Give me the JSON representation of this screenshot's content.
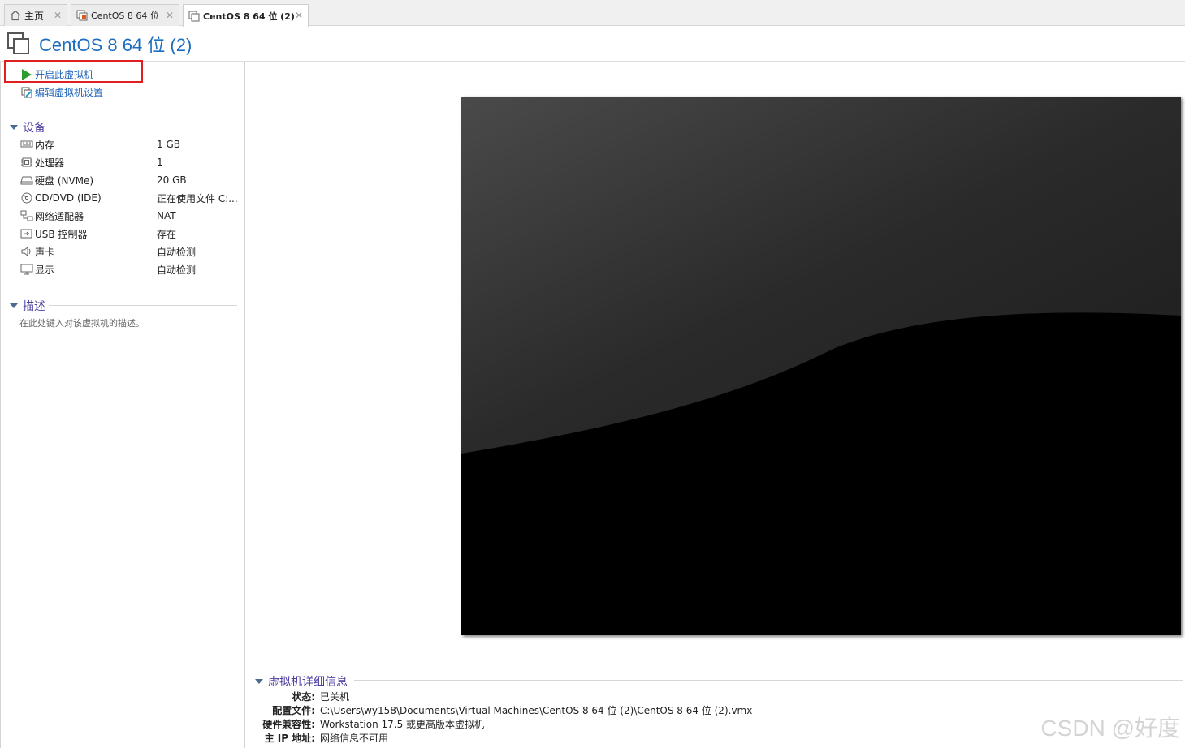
{
  "tabs": [
    {
      "label": "主页",
      "icon": "home-icon"
    },
    {
      "label": "CentOS 8 64 位",
      "icon": "vm-running-icon"
    },
    {
      "label": "CentOS 8 64 位 (2)",
      "icon": "vm-icon"
    }
  ],
  "page": {
    "title": "CentOS 8 64 位 (2)"
  },
  "actions": {
    "power_on": "开启此虚拟机",
    "edit_settings": "编辑虚拟机设置"
  },
  "devices": {
    "heading": "设备",
    "items": [
      {
        "name": "内存",
        "value": "1 GB",
        "icon": "memory-icon"
      },
      {
        "name": "处理器",
        "value": "1",
        "icon": "cpu-icon"
      },
      {
        "name": "硬盘 (NVMe)",
        "value": "20 GB",
        "icon": "hard-disk-icon"
      },
      {
        "name": "CD/DVD (IDE)",
        "value": "正在使用文件 C:...",
        "icon": "cd-dvd-icon"
      },
      {
        "name": "网络适配器",
        "value": "NAT",
        "icon": "network-adapter-icon"
      },
      {
        "name": "USB 控制器",
        "value": "存在",
        "icon": "usb-icon"
      },
      {
        "name": "声卡",
        "value": "自动检测",
        "icon": "sound-card-icon"
      },
      {
        "name": "显示",
        "value": "自动检测",
        "icon": "display-icon"
      }
    ]
  },
  "description": {
    "heading": "描述",
    "placeholder": "在此处键入对该虚拟机的描述。"
  },
  "details": {
    "heading": "虚拟机详细信息",
    "rows": [
      {
        "key": "状态:",
        "value": "已关机"
      },
      {
        "key": "配置文件:",
        "value": "C:\\Users\\wy158\\Documents\\Virtual Machines\\CentOS 8 64 位 (2)\\CentOS 8 64 位 (2).vmx"
      },
      {
        "key": "硬件兼容性:",
        "value": "Workstation 17.5 或更高版本虚拟机"
      },
      {
        "key": "主 IP 地址:",
        "value": "网络信息不可用"
      }
    ]
  },
  "watermark": "CSDN @好度",
  "colors": {
    "accent": "#1e6dc0",
    "section": "#4b3fa0",
    "highlight": "#e02020",
    "play": "#2e9c2e"
  }
}
